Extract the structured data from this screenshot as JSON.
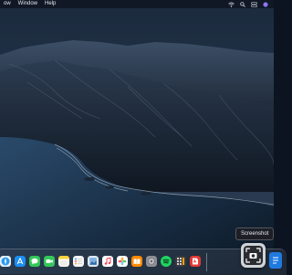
{
  "menubar": {
    "items": [
      {
        "label": "ow"
      },
      {
        "label": "Window"
      },
      {
        "label": "Help"
      }
    ],
    "status_icons": [
      "wifi-icon",
      "search-icon",
      "control-center-icon",
      "siri-icon"
    ]
  },
  "tooltip": {
    "label": "Screenshot"
  },
  "dock": {
    "apps": [
      {
        "name": "safari-icon",
        "color": "#2a9cf0"
      },
      {
        "name": "app-store-icon",
        "color": "#1c8ef2"
      },
      {
        "name": "messages-icon",
        "color": "#33c759"
      },
      {
        "name": "facetime-icon",
        "color": "#34c85a"
      },
      {
        "name": "notes-icon",
        "color": "#f7d23e"
      },
      {
        "name": "reminders-icon",
        "color": "#f2f2f2"
      },
      {
        "name": "preview-icon",
        "color": "#dfe8f2"
      },
      {
        "name": "music-icon",
        "color": "#fa3c55"
      },
      {
        "name": "photos-icon",
        "color": "#ff9f0a"
      },
      {
        "name": "books-icon",
        "color": "#ff8a00"
      },
      {
        "name": "system-preferences-icon",
        "color": "#8e8e93"
      },
      {
        "name": "spotify-icon",
        "color": "#1ed760"
      },
      {
        "name": "calculator-icon",
        "color": "#5a5a5e"
      },
      {
        "name": "pdf-app-icon",
        "color": "#e53935"
      },
      {
        "name": "screenshot-icon",
        "color": "#d0d4d9"
      },
      {
        "name": "partial-app-icon",
        "color": "#1f7ae0"
      }
    ]
  }
}
